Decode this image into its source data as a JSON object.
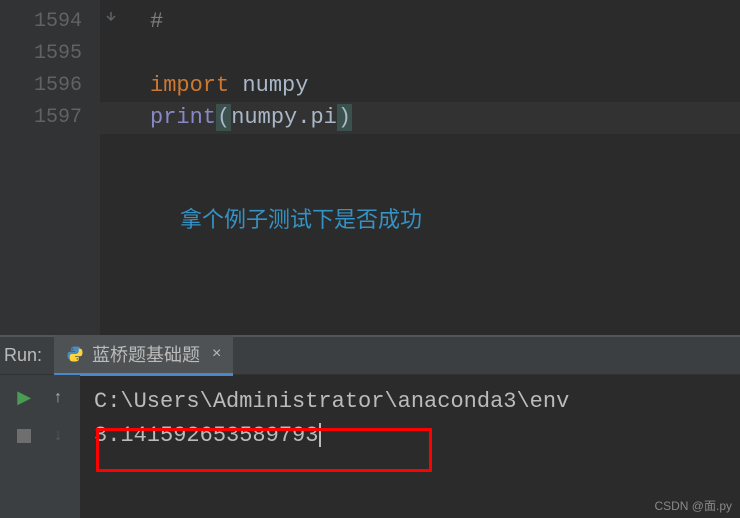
{
  "editor": {
    "lines": {
      "l1594": "1594",
      "l1595": "1595",
      "l1596": "1596",
      "l1597": "1597"
    },
    "code": {
      "comment_hash": "#",
      "kw_import": "import",
      "sp": " ",
      "mod_numpy": "numpy",
      "fn_print": "print",
      "paren_open": "(",
      "attr_numpy": "numpy",
      "dot": ".",
      "attr_pi": "pi",
      "paren_close": ")"
    },
    "annotation": "拿个例子测试下是否成功"
  },
  "run": {
    "label": "Run:",
    "tab_title": "蓝桥题基础题",
    "console": {
      "path": "C:\\Users\\Administrator\\anaconda3\\env",
      "output": "3.141592653589793"
    }
  },
  "watermark": "CSDN @面.py"
}
